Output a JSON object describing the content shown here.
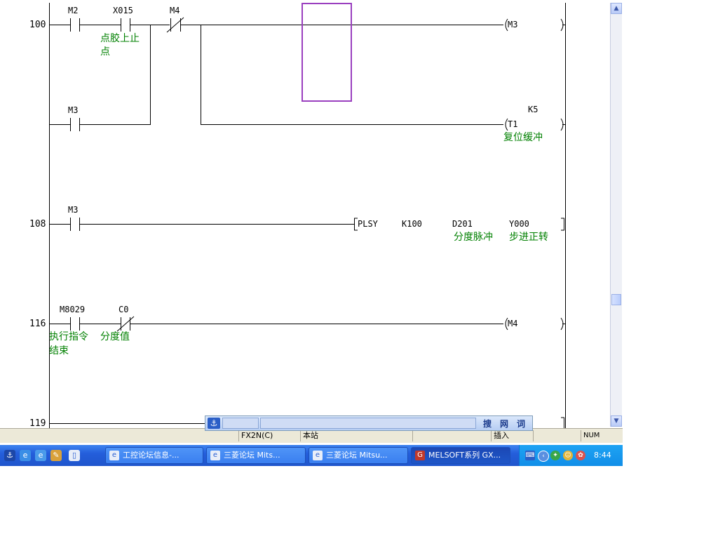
{
  "rungs": {
    "r100": {
      "step": "100"
    },
    "r108": {
      "step": "108"
    },
    "r116": {
      "step": "116"
    },
    "r119": {
      "step": "119"
    }
  },
  "contacts": {
    "m2": {
      "label": "M2"
    },
    "x015": {
      "label": "X015",
      "comment_line1": "点胶上止",
      "comment_line2": "点"
    },
    "m4": {
      "label": "M4"
    },
    "m3a": {
      "label": "M3"
    },
    "m3b": {
      "label": "M3"
    },
    "m8029": {
      "label": "M8029",
      "comment_line1": "执行指令",
      "comment_line2": "结束"
    },
    "c0": {
      "label": "C0",
      "comment": "分度值"
    }
  },
  "coils": {
    "m3": {
      "label": "M3"
    },
    "t1": {
      "label": "T1",
      "setting": "K5",
      "comment": "复位缓冲"
    },
    "m4": {
      "label": "M4"
    }
  },
  "instruction": {
    "mnemonic": "PLSY",
    "op1": "K100",
    "op2": "D201",
    "op2_comment": "分度脉冲",
    "op3": "Y000",
    "op3_comment": "步进正转"
  },
  "statusbar": {
    "cpu": "FX2N(C)",
    "station": "本站",
    "mode": "插入",
    "num": "NUM"
  },
  "ime": {
    "btn_search": "搜",
    "btn_web": "网",
    "btn_word": "词"
  },
  "taskbar": {
    "tasks": [
      {
        "label": "工控论坛信息-..."
      },
      {
        "label": "三菱论坛 Mits..."
      },
      {
        "label": "三菱论坛 Mitsu..."
      },
      {
        "label": "MELSOFT系列 GX..."
      }
    ],
    "clock": "8:44"
  }
}
